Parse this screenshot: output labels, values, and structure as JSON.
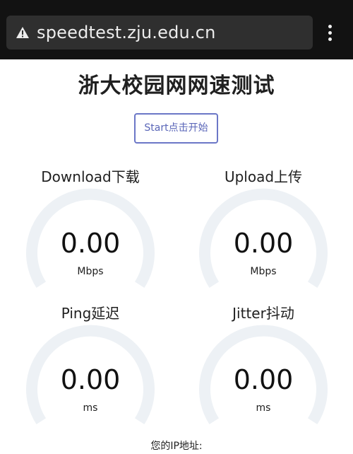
{
  "browser": {
    "url": "speedtest.zju.edu.cn",
    "security_icon": "warning-triangle-icon",
    "menu_icon": "more-vertical-icon"
  },
  "page": {
    "title": "浙大校园网网速测试",
    "start_label": "Start点击开始",
    "ip_label": "您的IP地址:"
  },
  "meters": {
    "download": {
      "label": "Download下载",
      "value": "0.00",
      "unit": "Mbps",
      "level": 0
    },
    "upload": {
      "label": "Upload上传",
      "value": "0.00",
      "unit": "Mbps",
      "level": 0
    },
    "ping": {
      "label": "Ping延迟",
      "value": "0.00",
      "unit": "ms",
      "level": 0
    },
    "jitter": {
      "label": "Jitter抖动",
      "value": "0.00",
      "unit": "ms",
      "level": 0
    }
  },
  "colors": {
    "browser_bar": "#121212",
    "url_pill": "#2f2f2f",
    "gauge_track": "#edf1f5",
    "button_border": "#6b77c7",
    "button_text": "#5a66b8"
  }
}
